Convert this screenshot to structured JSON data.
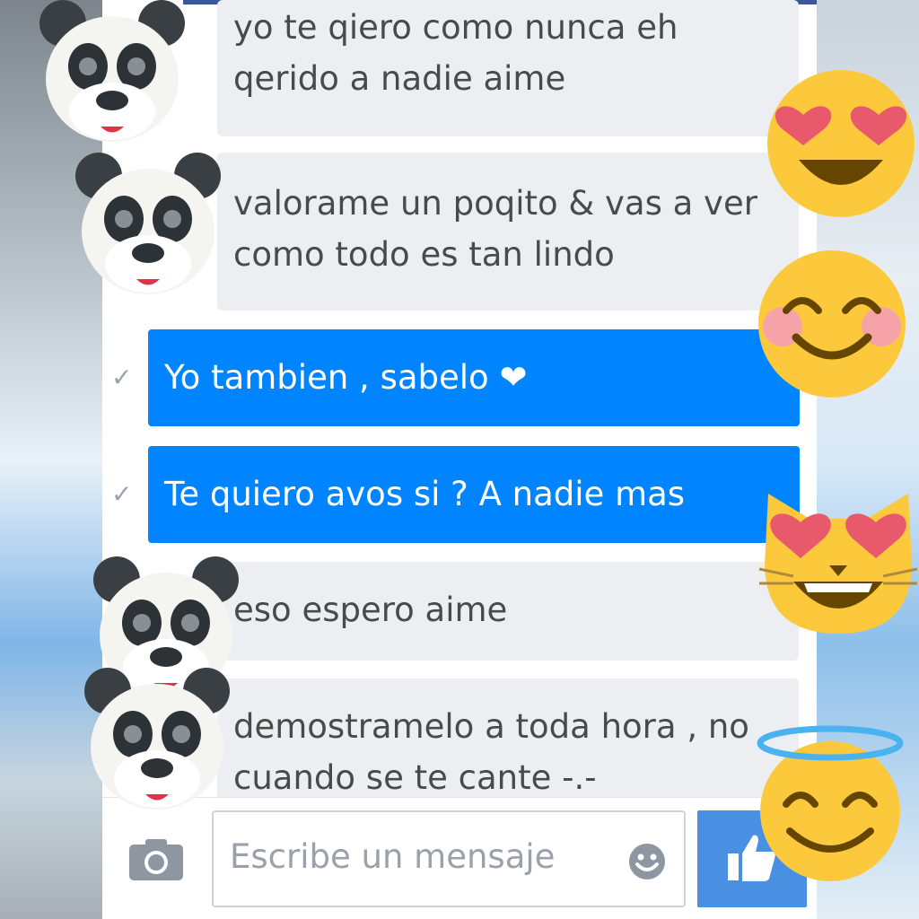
{
  "messages": [
    {
      "text": "yo te qiero como nunca eh\nqerido a nadie aime",
      "direction": "incoming"
    },
    {
      "text": "valorame un poqito & vas a ver\ncomo todo es tan lindo",
      "direction": "incoming"
    },
    {
      "text": "Yo tambien , sabelo ❤",
      "direction": "outgoing"
    },
    {
      "text": "Te quiero avos si ? A nadie mas",
      "direction": "outgoing"
    },
    {
      "text": "eso espero aime",
      "direction": "incoming"
    },
    {
      "text": "demostramelo a toda hora , no\ncuando se te cante -.-",
      "direction": "incoming"
    }
  ],
  "sent_mark": "✓",
  "composer": {
    "placeholder": "Escribe un mensaje",
    "icons": [
      "camera-icon",
      "smiley-icon",
      "thumbs-up-icon"
    ]
  },
  "stickers": [
    "panda-face",
    "heart-eyes-emoji",
    "smiling-blush-emoji",
    "heart-eyes-cat-emoji",
    "halo-smile-emoji"
  ],
  "colors": {
    "outgoing_bubble": "#0084ff",
    "incoming_bubble": "#eceef1",
    "like_button": "#4a90e2",
    "header_bar": "#3b5998"
  }
}
